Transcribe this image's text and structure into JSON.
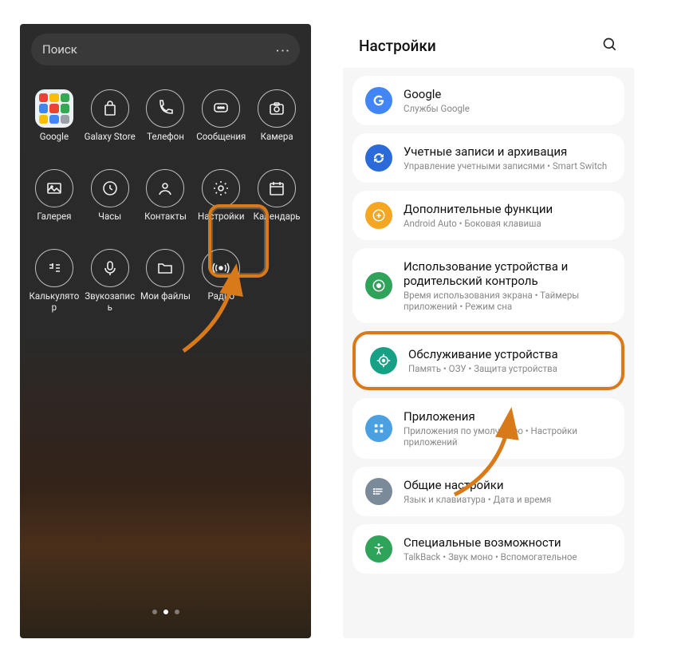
{
  "left": {
    "search_placeholder": "Поиск",
    "apps": [
      {
        "label": "Google",
        "kind": "folder"
      },
      {
        "label": "Galaxy Store",
        "kind": "shopping"
      },
      {
        "label": "Телефон",
        "kind": "phone"
      },
      {
        "label": "Сообщения",
        "kind": "messages"
      },
      {
        "label": "Камера",
        "kind": "camera"
      },
      {
        "label": "Галерея",
        "kind": "gallery"
      },
      {
        "label": "Часы",
        "kind": "clock"
      },
      {
        "label": "Контакты",
        "kind": "contacts"
      },
      {
        "label": "Настройки",
        "kind": "settings",
        "highlighted": true
      },
      {
        "label": "Календарь",
        "kind": "calendar"
      },
      {
        "label": "Калькулятор",
        "kind": "calculator"
      },
      {
        "label": "Звукозапись",
        "kind": "mic"
      },
      {
        "label": "Мои файлы",
        "kind": "files"
      },
      {
        "label": "Радио",
        "kind": "radio"
      }
    ],
    "page_dots": {
      "count": 3,
      "active": 1
    }
  },
  "right": {
    "header_title": "Настройки",
    "items": [
      {
        "title": "Google",
        "sub": "Службы Google",
        "color": "#4285f4",
        "icon": "google"
      },
      {
        "title": "Учетные записи и архивация",
        "sub": "Управление учетными записями  •  Smart Switch",
        "color": "#2a6bd9",
        "icon": "sync"
      },
      {
        "title": "Дополнительные функции",
        "sub": "Android Auto  •  Боковая клавиша",
        "color": "#f5a623",
        "icon": "plus"
      },
      {
        "title": "Использование устройства и родительский контроль",
        "sub": "Время использования экрана  •  Таймеры приложений  •  Режим сна",
        "color": "#2fa35a",
        "icon": "wellbeing"
      },
      {
        "title": "Обслуживание устройства",
        "sub": "Память  •  ОЗУ  •  Защита устройства",
        "color": "#16a085",
        "icon": "care",
        "highlighted": true
      },
      {
        "title": "Приложения",
        "sub": "Приложения по умолчанию  •  Настройки приложений",
        "color": "#4aa0e0",
        "icon": "apps"
      },
      {
        "title": "Общие настройки",
        "sub": "Язык и клавиатура  •  Дата и время",
        "color": "#7a8a99",
        "icon": "general"
      },
      {
        "title": "Специальные возможности",
        "sub": "TalkBack  •  Звук моно  •  Вспомогательное",
        "color": "#2fa35a",
        "icon": "accessibility"
      }
    ]
  },
  "annotation": {
    "hl_color": "#d97a1a"
  }
}
